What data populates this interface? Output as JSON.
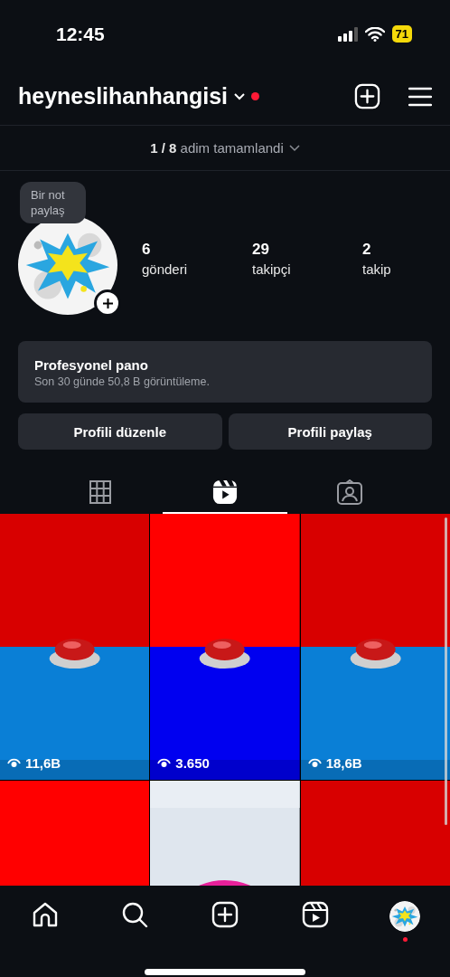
{
  "status_bar": {
    "time": "12:45",
    "battery": "71"
  },
  "header": {
    "username": "heyneslihanhangisi",
    "has_notification": true
  },
  "progress": {
    "text": "**1 / 8** adim tamamlandi"
  },
  "profile": {
    "note": "Bir not paylaş",
    "stats": [
      {
        "value": "6",
        "label": "gönderi"
      },
      {
        "value": "29",
        "label": "takipçi"
      },
      {
        "value": "2",
        "label": "takip"
      }
    ]
  },
  "dashboard": {
    "title": "Profesyonel pano",
    "subtitle": "Son 30 günde 50,8 B görüntüleme."
  },
  "buttons": [
    "Profili düzenle",
    "Profili paylaş"
  ],
  "tabs": [
    {
      "kind": "grid",
      "selected": false
    },
    {
      "kind": "reels",
      "selected": true
    },
    {
      "kind": "tagged",
      "selected": false
    }
  ],
  "reels": [
    {
      "kind": "picture",
      "views": "11,6B"
    },
    {
      "kind": "picture",
      "views": "3.650"
    },
    {
      "kind": "picture",
      "views": "18,6B"
    },
    {
      "kind": "picture"
    },
    {
      "kind": "picture"
    },
    {
      "kind": "picture"
    }
  ],
  "nav": [
    {
      "kind": "home",
      "selected": false
    },
    {
      "kind": "search",
      "selected": false
    },
    {
      "kind": "create",
      "selected": false
    },
    {
      "kind": "reels",
      "selected": false
    },
    {
      "kind": "profile",
      "selected": true
    }
  ]
}
